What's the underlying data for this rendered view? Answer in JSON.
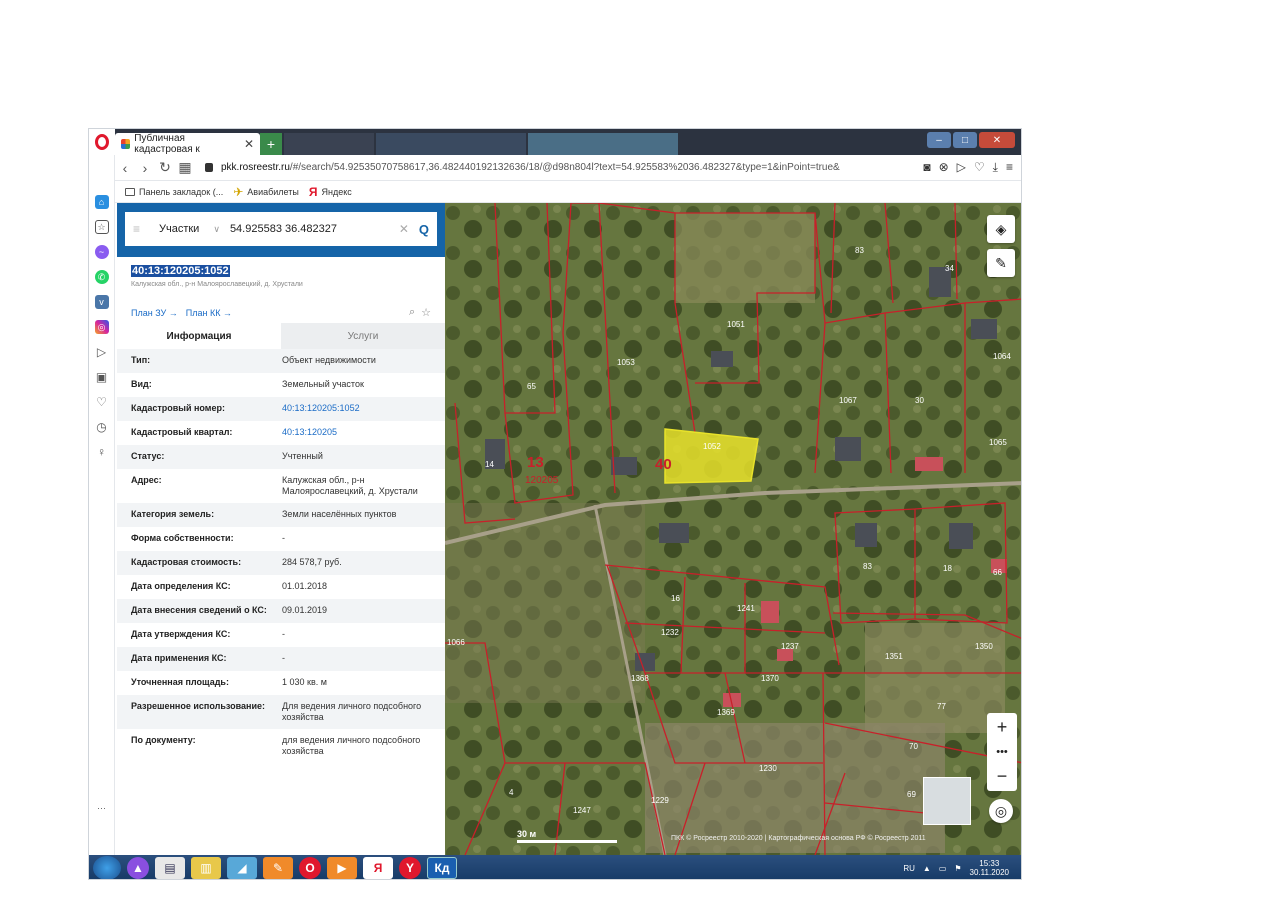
{
  "browser": {
    "active_tab": "Публичная кадастровая к",
    "url_host": "pkk.rosreestr.ru",
    "url_rest": "/#/search/54.92535070758617,36.482440192132636/18/@d98n804l?text=54.925583%2036.482327&type=1&inPoint=true&",
    "bookmarks": [
      "Панель закладок (...",
      "Авиабилеты",
      "Яндекс"
    ]
  },
  "search": {
    "type": "Участки",
    "query": "54.925583 36.482327"
  },
  "parcel": {
    "cadastral_number": "40:13:120205:1052",
    "subtitle": "Калужская обл., р-н Малоярославецкий, д. Хрустали",
    "link_plan_zu": "План ЗУ →",
    "link_plan_kk": "План КК →"
  },
  "tabs": {
    "info": "Информация",
    "services": "Услуги"
  },
  "info_rows": [
    {
      "key": "Тип:",
      "value": "Объект недвижимости"
    },
    {
      "key": "Вид:",
      "value": "Земельный участок"
    },
    {
      "key": "Кадастровый номер:",
      "value": "40:13:120205:1052"
    },
    {
      "key": "Кадастровый квартал:",
      "value": "40:13:120205"
    },
    {
      "key": "Статус:",
      "value": "Учтенный"
    },
    {
      "key": "Адрес:",
      "value": "Калужская обл., р-н Малоярославецкий, д. Хрустали"
    },
    {
      "key": "Категория земель:",
      "value": "Земли населённых пунктов"
    },
    {
      "key": "Форма собственности:",
      "value": "-"
    },
    {
      "key": "Кадастровая стоимость:",
      "value": "284 578,7 руб."
    },
    {
      "key": "Дата определения КС:",
      "value": "01.01.2018"
    },
    {
      "key": "Дата внесения сведений о КС:",
      "value": "09.01.2019"
    },
    {
      "key": "Дата утверждения КС:",
      "value": "-"
    },
    {
      "key": "Дата применения КС:",
      "value": "-"
    },
    {
      "key": "Уточненная площадь:",
      "value": "1 030 кв. м"
    },
    {
      "key": "Разрешенное использование:",
      "value": "Для ведения личного подсобного хозяйства"
    },
    {
      "key": "По документу:",
      "value": "для ведения личного подсобного хозяйства"
    }
  ],
  "map": {
    "parcel_labels": [
      "83",
      "34",
      "1051",
      "1053",
      "65",
      "1064",
      "1067",
      "30",
      "1052",
      "40",
      "13",
      "120205",
      "14",
      "1065",
      "83",
      "18",
      "66",
      "16",
      "1241",
      "1232",
      "1237",
      "1351",
      "1350",
      "1066",
      "1368",
      "1370",
      "1369",
      "77",
      "70",
      "1230",
      "69",
      "1229",
      "1247",
      "4"
    ],
    "scale_label": "30 м",
    "copyright": "ПКК © Росреестр 2010-2020 | Картографическая основа РФ © Росреестр 2011",
    "highlight_color": "#e8e22a",
    "boundary_color": "#c8202a"
  },
  "taskbar": {
    "lang": "RU",
    "time": "15:33",
    "date": "30.11.2020"
  }
}
